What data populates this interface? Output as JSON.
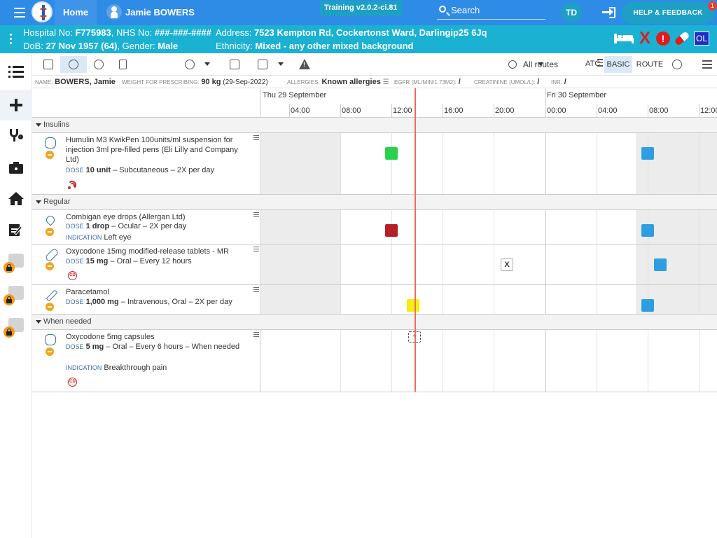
{
  "topbar": {
    "home_label": "Home",
    "patient_name": "Jamie BOWERS",
    "training_label": "Training v2.0.2-ci.81",
    "search_label": "Search",
    "user_initials": "TD",
    "help_label": "HELP & FEEDBACK",
    "help_count": "1"
  },
  "banner": {
    "hospital_no_label": "Hospital No:",
    "hospital_no": "F775983",
    "nhs_no_label": "NHS No:",
    "nhs_no": "###-###-####",
    "dob_label": "DoB:",
    "dob": "27 Nov 1957 (64)",
    "gender_label": "Gender:",
    "gender": "Male",
    "address_label": "Address:",
    "address": "7523 Kempton Rd, Cockertonst Ward, Darlingip25 6Jq",
    "ethnicity_label": "Ethnicity:",
    "ethnicity": "Mixed - any other mixed background",
    "ol_label": "OL",
    "alert_label": "!",
    "x_label": "X"
  },
  "toolbar": {
    "routes_label": "All routes",
    "atc_label": "ATC",
    "basic_label": "BASIC",
    "route_label": "ROUTE"
  },
  "info": {
    "name_label": "NAME:",
    "name": "BOWERS, Jamie",
    "weight_label": "WEIGHT FOR PRESCRIBING:",
    "weight": "90 kg",
    "weight_date": "(29-Sep-2022)",
    "allergies_label": "ALLERGIES:",
    "allergies": "Known allergies",
    "egfr_label": "EGFR (ML/MIN/1.73M2):",
    "egfr": "/",
    "creatinine_label": "CREATININE (UMOL/L):",
    "creatinine": "/",
    "inr_label": "INR:",
    "inr": "/"
  },
  "timeline": {
    "day1": "Thu 29 September",
    "day2": "Fri 30 September",
    "hours": [
      "04:00",
      "08:00",
      "12:00",
      "16:00",
      "20:00",
      "00:00",
      "04:00",
      "08:00",
      "12:00"
    ]
  },
  "sections": {
    "insulins": "Insulins",
    "regular": "Regular",
    "when_needed": "When needed"
  },
  "meds": {
    "humulin": {
      "name": "Humulin M3 KwikPen 100units/ml suspension for injection 3ml pre-filled pens (Eli Lilly and Company Ltd)",
      "dose_label": "DOSE",
      "dose": "10 unit",
      "detail": "– Subcutaneous – 2X per day"
    },
    "combigan": {
      "name": "Combigan eye drops (Allergan Ltd)",
      "dose_label": "DOSE",
      "dose": "1 drop",
      "detail": "– Ocular – 2X per day",
      "indication_label": "INDICATION",
      "indication": "Left eye"
    },
    "oxy_mr": {
      "name": "Oxycodone 15mg modified-release tablets - MR",
      "dose_label": "DOSE",
      "dose": "15 mg",
      "detail": "– Oral – Every 12 hours",
      "cd_label": "CD",
      "missed_label": "X"
    },
    "paracetamol": {
      "name": "Paracetamol",
      "dose_label": "DOSE",
      "dose": "1,000 mg",
      "detail": "– Intravenous, Oral – 2X per day"
    },
    "oxy_caps": {
      "name": "Oxycodone 5mg capsules",
      "dose_label": "DOSE",
      "dose": "5 mg",
      "detail": "– Oral – Every 6 hours – When needed",
      "indication_label": "INDICATION",
      "indication": "Breakthrough pain",
      "cd_label": "CD",
      "add_label": "+"
    }
  },
  "colors": {
    "topbar": "#2e8be6",
    "banner": "#1bb1d2",
    "dose_given": "#2bd14e",
    "dose_missed": "#b32025",
    "dose_due": "#2e9ee0",
    "dose_current": "#f4ef0c",
    "now_line": "#ef6b5e"
  }
}
